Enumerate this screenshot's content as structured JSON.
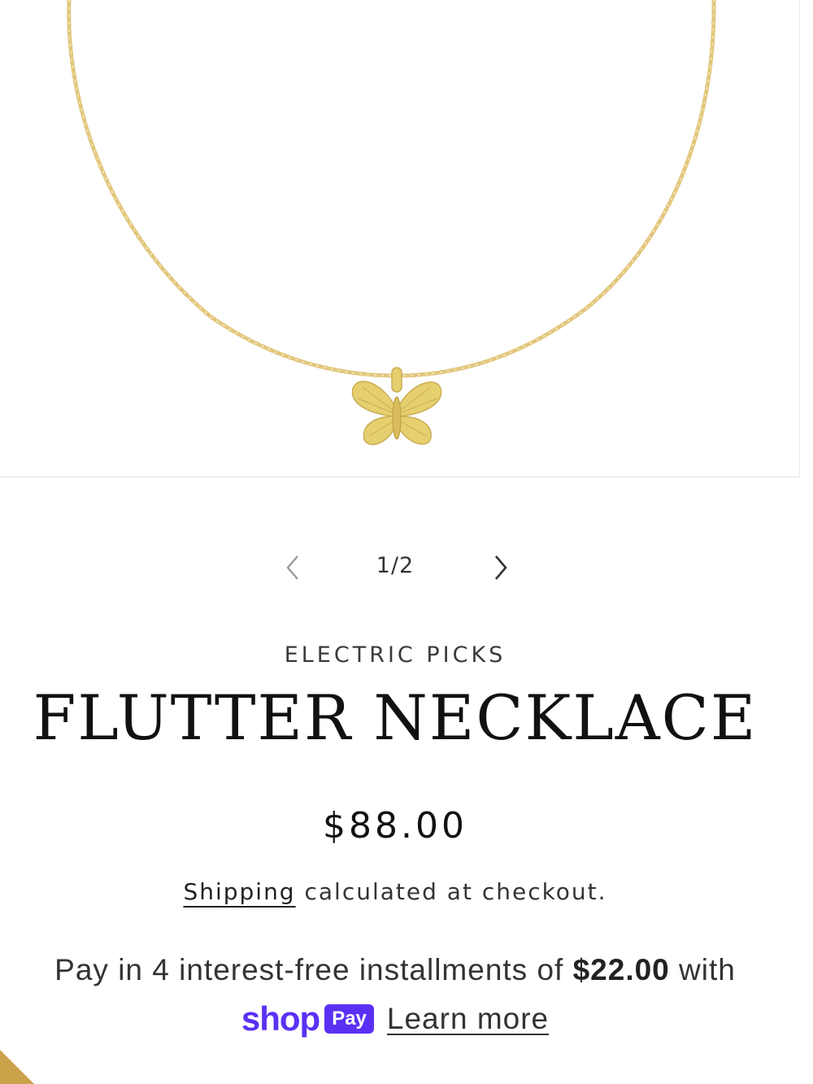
{
  "gallery": {
    "counter": "1/2",
    "chain_color": "#e2c67c",
    "pendant_color": "#e6cf6e"
  },
  "product": {
    "vendor": "ELECTRIC PICKS",
    "title": "FLUTTER NECKLACE",
    "price": "$88.00"
  },
  "shipping": {
    "link_label": "Shipping",
    "rest": " calculated at checkout."
  },
  "installments": {
    "prefix": "Pay in 4 interest-free installments of ",
    "amount": "$22.00",
    "suffix": " with",
    "shop_word": "shop",
    "pay_badge": "Pay",
    "learn_more": "Learn more",
    "brand_color": "#5a31f4"
  }
}
